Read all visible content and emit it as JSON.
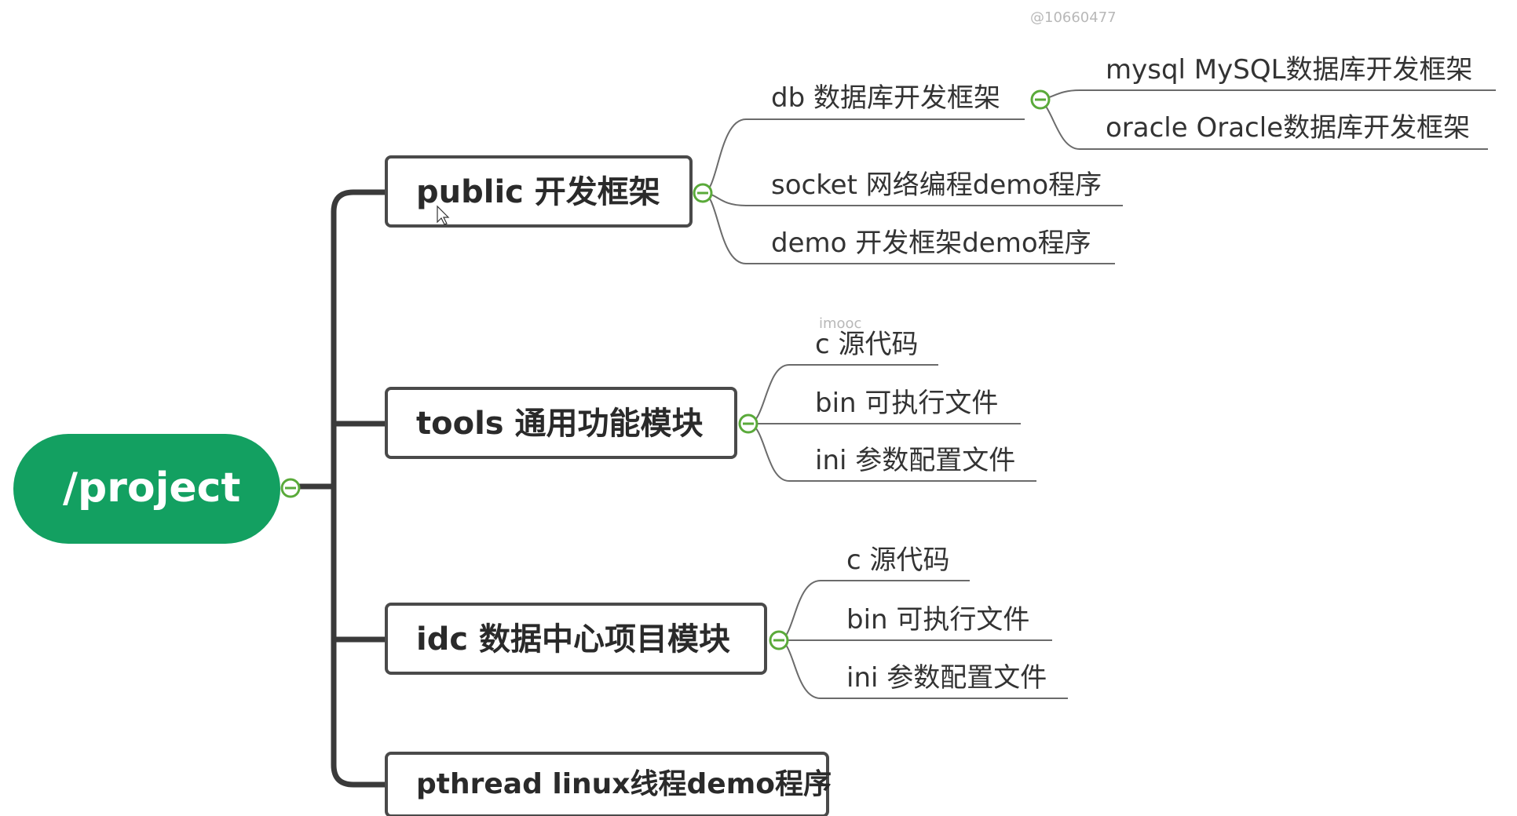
{
  "watermarks": {
    "top": "@10660477",
    "mid": "imooc"
  },
  "colors": {
    "root_fill": "#13a061",
    "collapse_accent": "#5aaa3a",
    "line_dark": "#3a3a3a"
  },
  "mindmap": {
    "root": "/project",
    "branches": [
      {
        "label": "public 开发框架",
        "children": [
          {
            "label": "db 数据库开发框架",
            "children": [
              {
                "label": "mysql MySQL数据库开发框架"
              },
              {
                "label": "oracle Oracle数据库开发框架"
              }
            ]
          },
          {
            "label": "socket 网络编程demo程序"
          },
          {
            "label": "demo 开发框架demo程序"
          }
        ]
      },
      {
        "label": "tools 通用功能模块",
        "children": [
          {
            "label": "c 源代码"
          },
          {
            "label": "bin 可执行文件"
          },
          {
            "label": "ini 参数配置文件"
          }
        ]
      },
      {
        "label": "idc 数据中心项目模块",
        "children": [
          {
            "label": "c 源代码"
          },
          {
            "label": "bin 可执行文件"
          },
          {
            "label": "ini 参数配置文件"
          }
        ]
      },
      {
        "label": "pthread linux线程demo程序",
        "children": []
      }
    ]
  }
}
